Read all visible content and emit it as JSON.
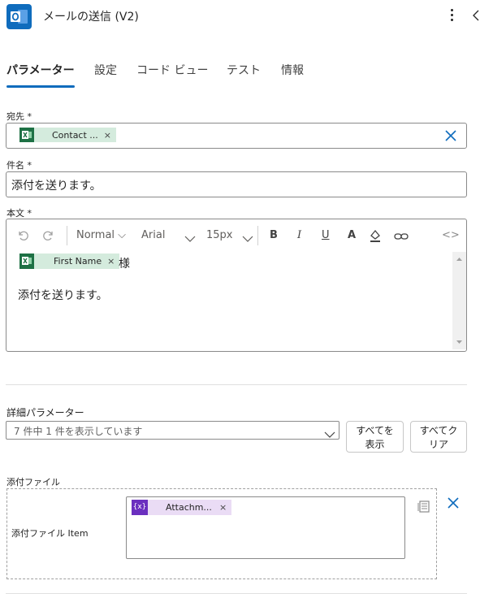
{
  "header": {
    "title": "メールの送信 (V2)"
  },
  "tabs": [
    {
      "label": "パラメーター"
    },
    {
      "label": "設定"
    },
    {
      "label": "コード ビュー"
    },
    {
      "label": "テスト"
    },
    {
      "label": "情報"
    }
  ],
  "to": {
    "label": "宛先 *",
    "token": "Contact ...",
    "token_remove": "×"
  },
  "subject": {
    "label": "件名 *",
    "value": "添付を送ります。"
  },
  "body": {
    "label": "本文 *",
    "toolbar": {
      "format": "Normal",
      "font": "Arial",
      "size": "15px",
      "bold": "B",
      "italic": "I",
      "underline": "U",
      "font_color": "A",
      "code_view": "<>"
    },
    "token": "First Name",
    "token_remove": "×",
    "suffix": "様",
    "text": "添付を送ります。"
  },
  "advanced": {
    "label": "詳細パラメーター",
    "select_value": "7 件中 1 件を表示しています",
    "show_all_line1": "すべてを",
    "show_all_line2": "表示",
    "clear_all_line1": "すべてク",
    "clear_all_line2": "リア"
  },
  "attachments": {
    "label": "添付ファイル",
    "item_label": "添付ファイル Item",
    "token": "Attachm...",
    "token_remove": "×",
    "token_icon": "{x}"
  },
  "colors": {
    "accent": "#0f6cbd",
    "excel_green": "#1e7145",
    "excel_token_bg": "#d4ebdd",
    "variable_purple": "#6b2fbf",
    "variable_token_bg": "#eadcf5"
  }
}
